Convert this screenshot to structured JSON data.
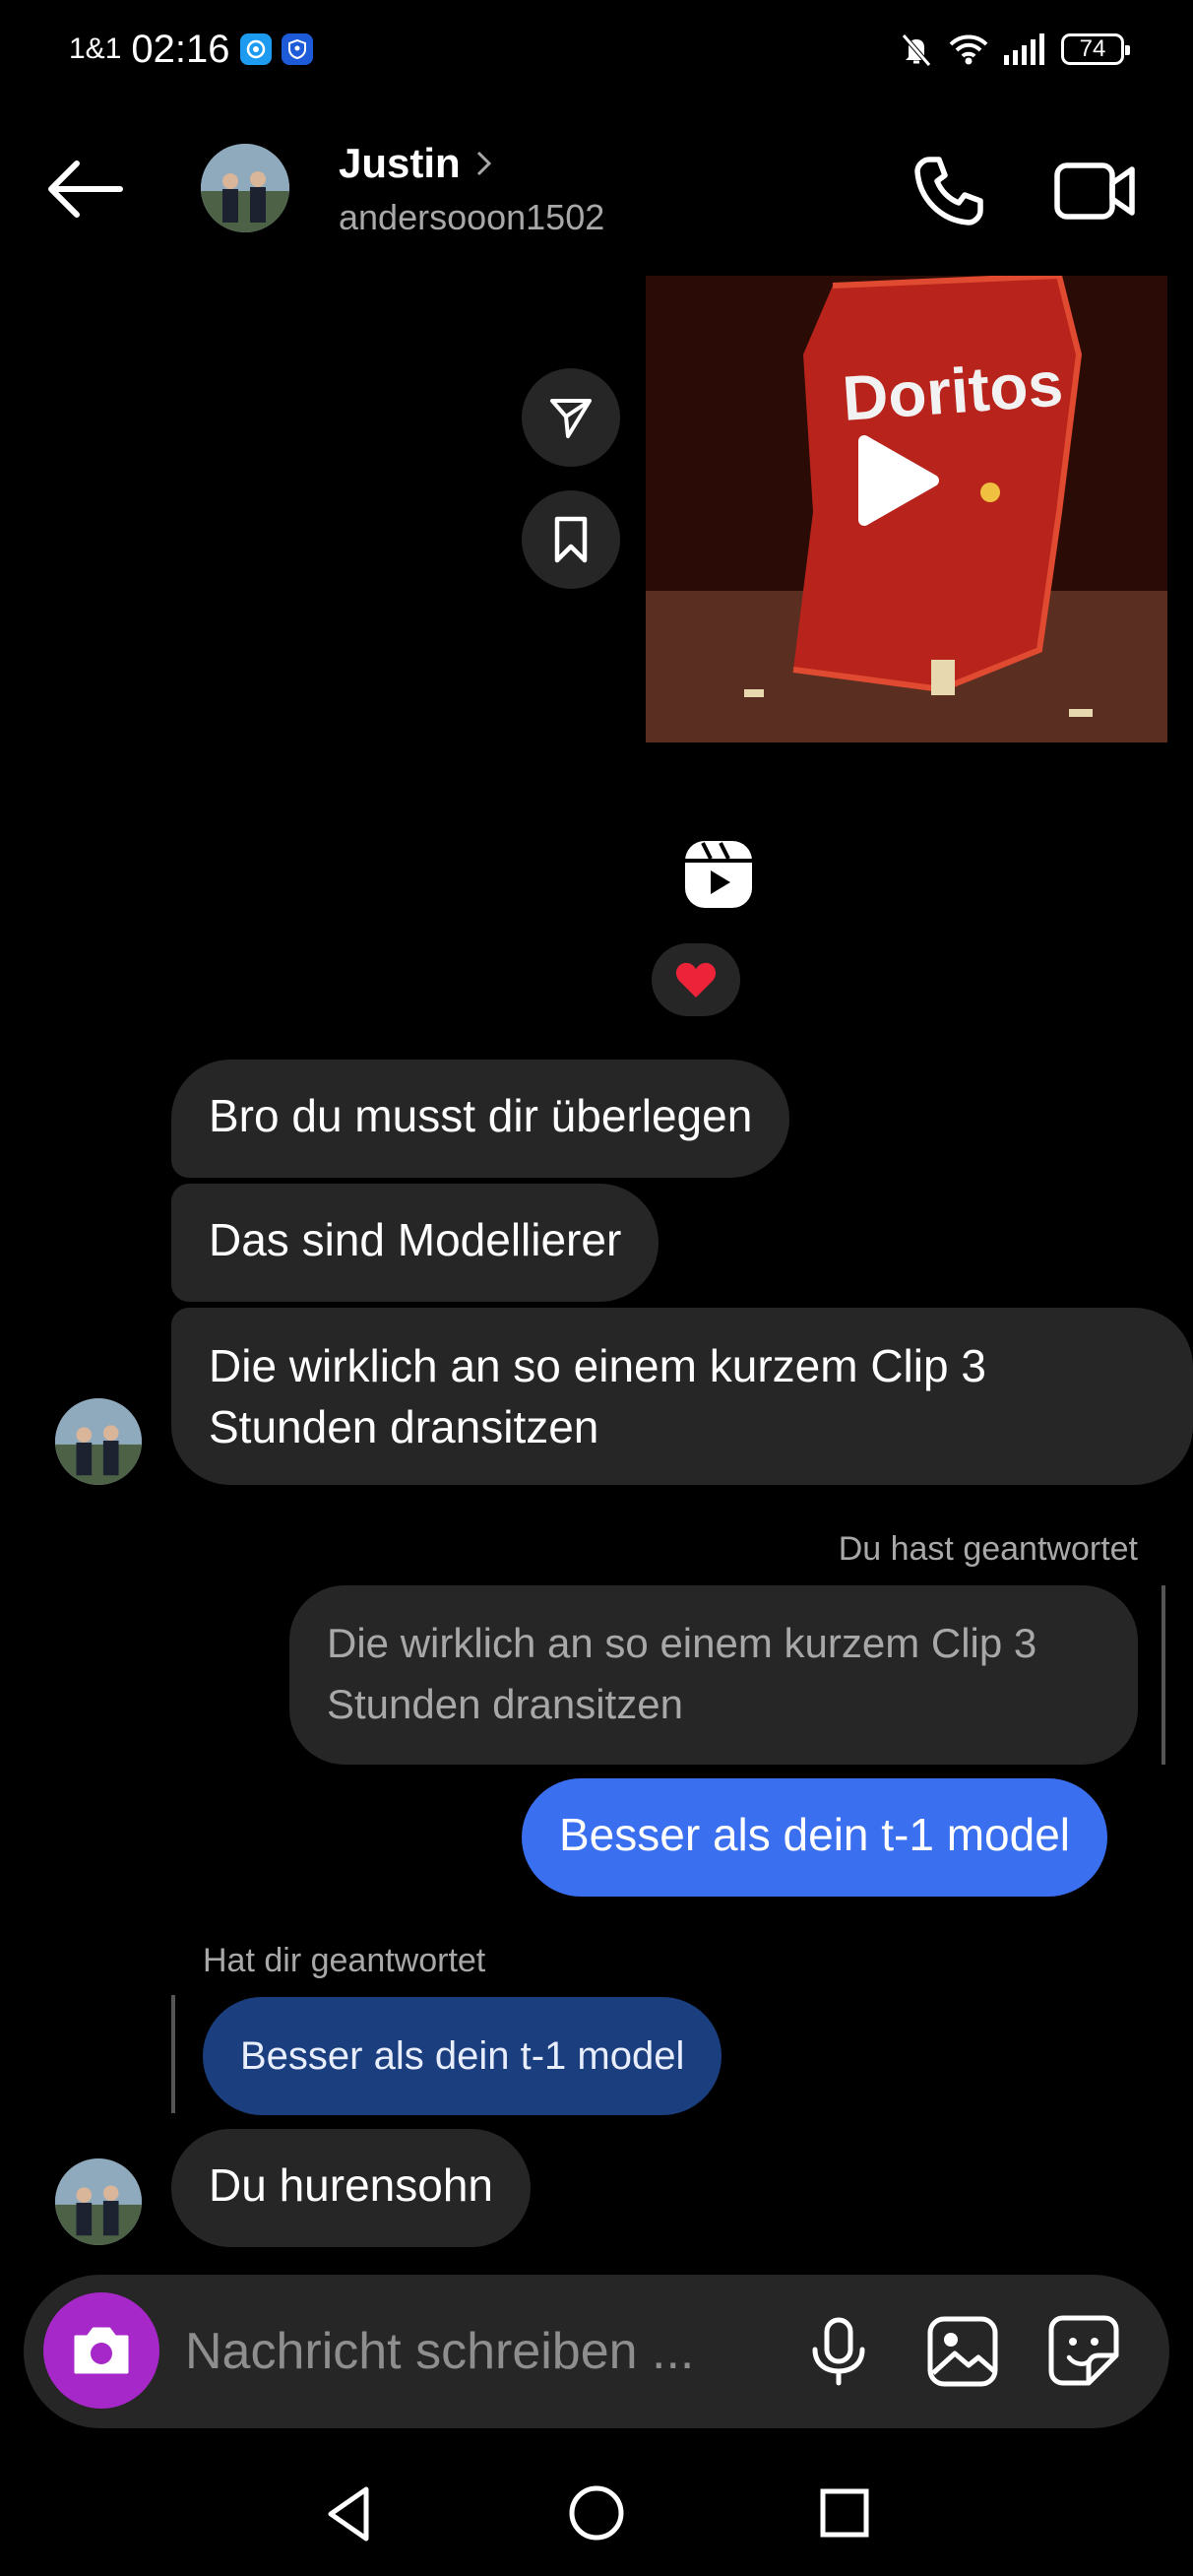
{
  "status_bar": {
    "carrier": "1&1",
    "time": "02:16",
    "battery": "74"
  },
  "header": {
    "contact_name": "Justin",
    "username": "andersooon1502"
  },
  "reel": {
    "thumbnail_text": "Doritos",
    "reaction": "❤️"
  },
  "messages": {
    "incoming_1": "Bro du musst dir überlegen",
    "incoming_2": "Das sind Modellierer",
    "incoming_3": "Die wirklich an so einem kurzem Clip 3 Stunden dransitzen",
    "outgoing_reply_label": "Du hast geantwortet",
    "outgoing_quoted": "Die wirklich an so einem kurzem Clip 3 Stunden dransitzen",
    "outgoing_1": "Besser als dein t-1 model",
    "incoming_reply_label": "Hat dir geantwortet",
    "incoming_quoted": "Besser als dein t-1 model",
    "incoming_4": "Du hurensohn"
  },
  "composer": {
    "placeholder": "Nachricht schreiben ..."
  },
  "colors": {
    "background": "#000000",
    "incoming_bubble": "#262626",
    "outgoing_bubble": "#3a6ff0",
    "camera_button": "#a628c8"
  },
  "icons": [
    "back-arrow-icon",
    "phone-icon",
    "video-camera-icon",
    "send-icon",
    "bookmark-icon",
    "reels-icon",
    "play-icon",
    "camera-icon",
    "microphone-icon",
    "gallery-icon",
    "sticker-icon",
    "nav-back-icon",
    "nav-home-icon",
    "nav-recents-icon"
  ]
}
